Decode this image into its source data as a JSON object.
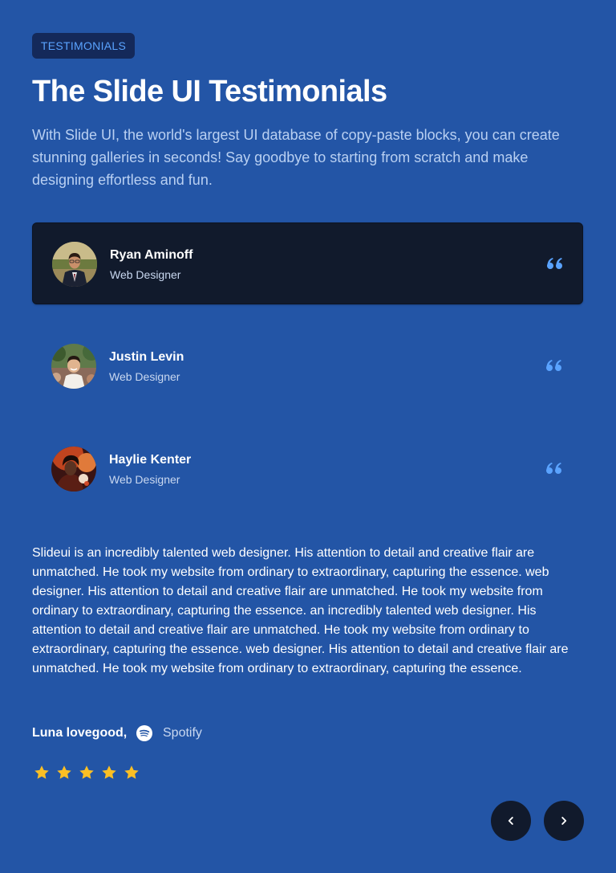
{
  "header": {
    "badge": "TESTIMONIALS",
    "title": "The Slide UI Testimonials",
    "intro": "With Slide UI, the world's largest UI database of copy-paste blocks, you can create stunning galleries in seconds! Say goodbye to starting from scratch and make designing effortless and fun."
  },
  "testimonials": [
    {
      "name": "Ryan Aminoff",
      "role": "Web Designer",
      "active": true
    },
    {
      "name": "Justin Levin",
      "role": "Web Designer",
      "active": false
    },
    {
      "name": "Haylie Kenter",
      "role": "Web Designer",
      "active": false
    }
  ],
  "active_testimonial": {
    "text": "Slideui is an incredibly talented web designer. His attention to detail and creative flair are unmatched. He took my website from ordinary to extraordinary, capturing the essence. web designer. His attention to detail and creative flair are unmatched. He took my website from ordinary to extraordinary, capturing the essence. an incredibly talented web designer. His attention to detail and creative flair are unmatched. He took my website from ordinary to extraordinary, capturing the essence. web designer. His attention to detail and creative flair are unmatched. He took my website from ordinary to extraordinary, capturing the essence.",
    "author": "Luna lovegood,",
    "company": "Spotify",
    "company_icon": "spotify-icon",
    "rating": 5,
    "rating_max": 5
  },
  "navigation": {
    "prev_icon": "chevron-left-icon",
    "next_icon": "chevron-right-icon"
  },
  "colors": {
    "background": "#2355a6",
    "card_active": "#111a2c",
    "accent": "#5aa3ff",
    "star": "#fbbf24",
    "badge_bg": "#14295a"
  }
}
